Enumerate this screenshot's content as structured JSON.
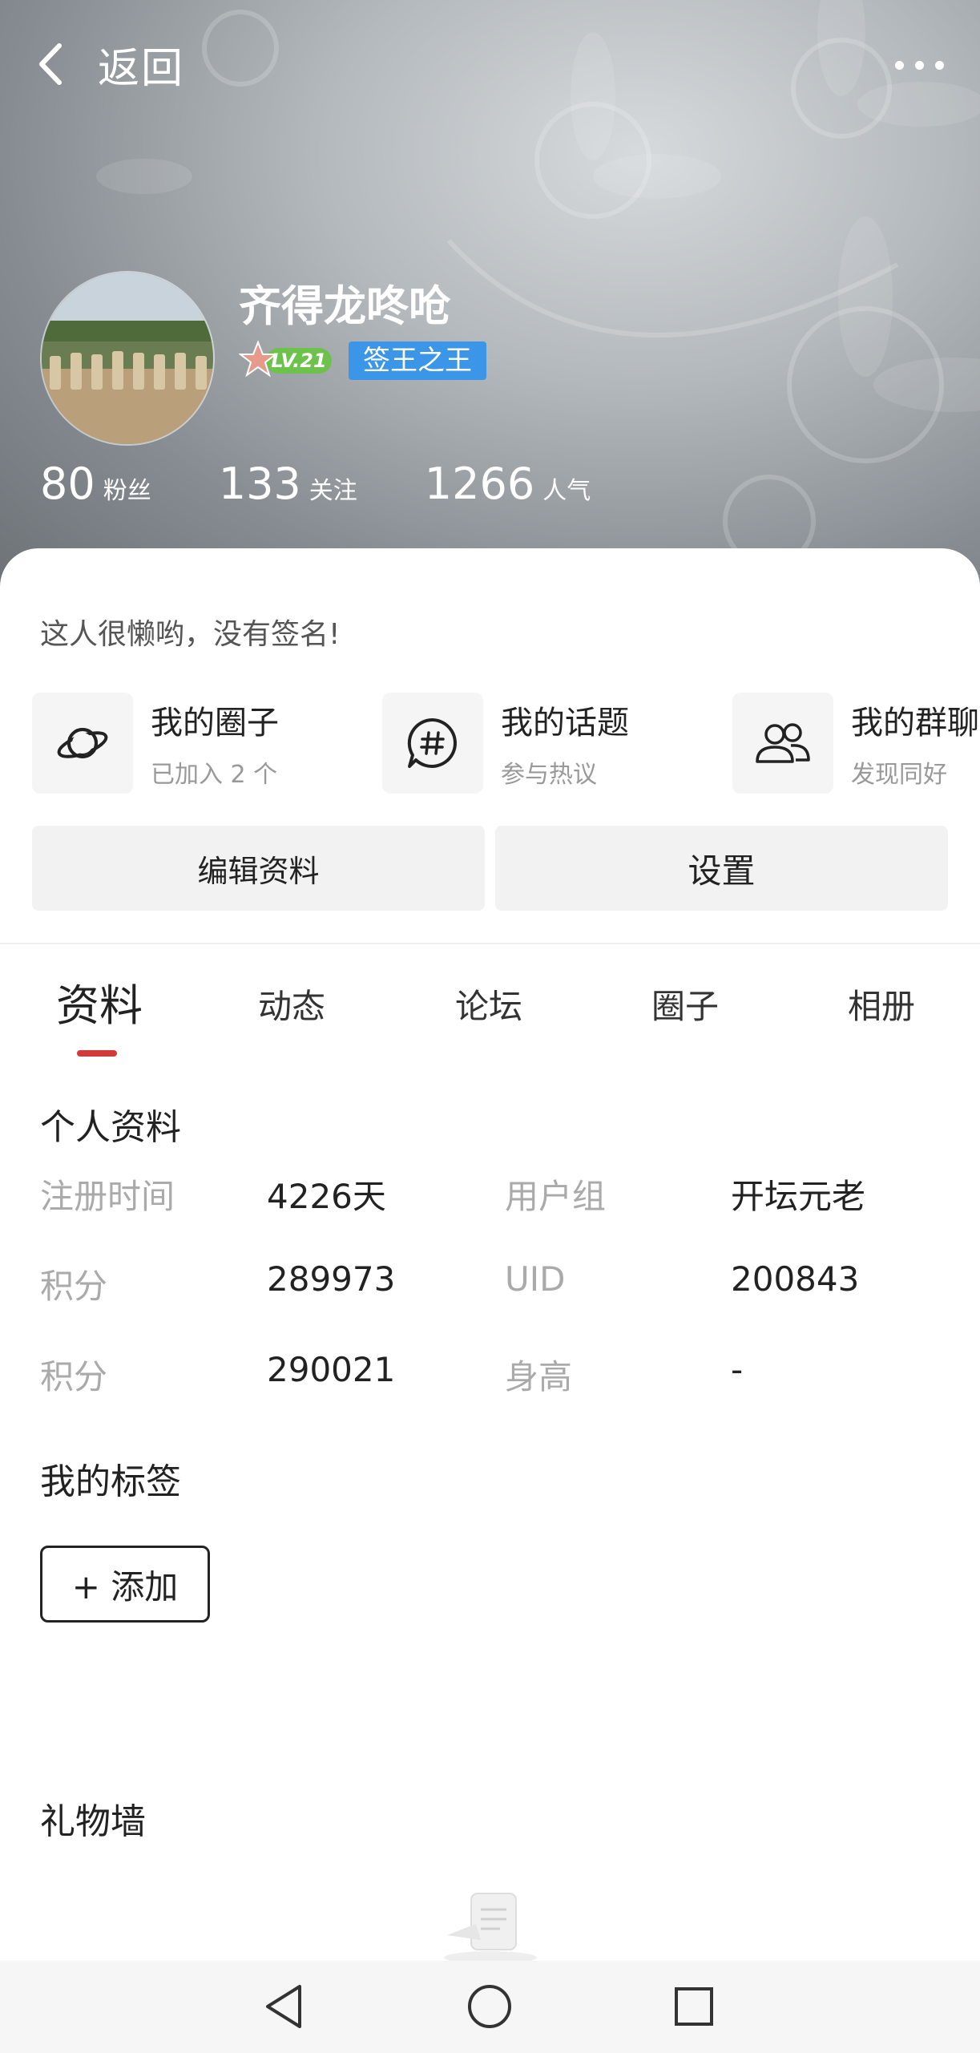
{
  "header": {
    "back_label": "返回",
    "more_icon": "more-dots-icon"
  },
  "profile": {
    "username": "齐得龙咚呛",
    "level": "LV.21",
    "title_badge": "签王之王",
    "stats": [
      {
        "num": "80",
        "label": "粉丝"
      },
      {
        "num": "133",
        "label": "关注"
      },
      {
        "num": "1266",
        "label": "人气"
      }
    ],
    "signature": "这人很懒哟，没有签名!"
  },
  "shortcuts": [
    {
      "title": "我的圈子",
      "subtitle": "已加入 2 个",
      "icon": "planet-icon"
    },
    {
      "title": "我的话题",
      "subtitle": "参与热议",
      "icon": "topic-hash-icon"
    },
    {
      "title": "我的群聊",
      "subtitle": "发现同好",
      "icon": "group-users-icon"
    }
  ],
  "buttons": {
    "edit_profile": "编辑资料",
    "settings": "设置"
  },
  "tabs": [
    "资料",
    "动态",
    "论坛",
    "圈子",
    "相册"
  ],
  "active_tab": "资料",
  "personal_info": {
    "title": "个人资料",
    "rows": [
      [
        {
          "k": "注册时间",
          "v": "4226天"
        },
        {
          "k": "用户组",
          "v": "开坛元老"
        }
      ],
      [
        {
          "k": "积分",
          "v": "289973"
        },
        {
          "k": "UID",
          "v": "200843"
        }
      ],
      [
        {
          "k": "积分",
          "v": "290021"
        },
        {
          "k": "身高",
          "v": "-"
        }
      ]
    ]
  },
  "tags": {
    "title": "我的标签",
    "add_label": "+ 添加"
  },
  "gifts": {
    "title": "礼物墙"
  },
  "colors": {
    "accent_red": "#d23a3a",
    "badge_blue": "#3b96e8",
    "level_green": "#6cc24a"
  }
}
